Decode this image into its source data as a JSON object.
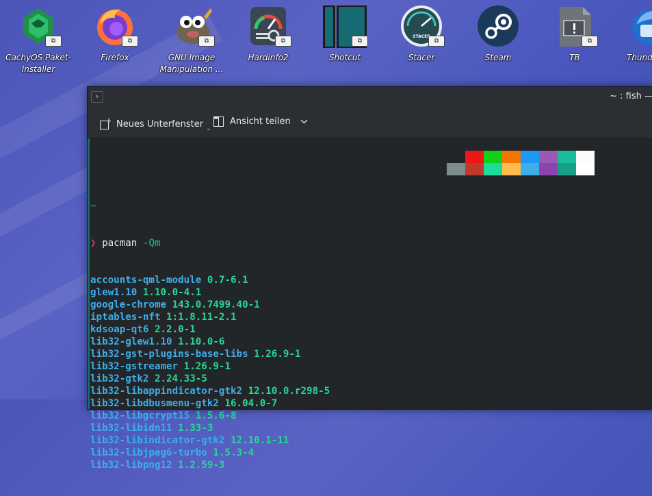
{
  "desktop": {
    "icons": [
      {
        "label_line1": "CachyOS Paket-",
        "label_line2": "Installer",
        "icon": "cachyos-package-installer-icon"
      },
      {
        "label_line1": "Firefox",
        "label_line2": "",
        "icon": "firefox-icon"
      },
      {
        "label_line1": "GNU Image",
        "label_line2": "Manipulation ...",
        "icon": "gimp-icon"
      },
      {
        "label_line1": "Hardinfo2",
        "label_line2": "",
        "icon": "hardinfo2-icon"
      },
      {
        "label_line1": "Shotcut",
        "label_line2": "",
        "icon": "shotcut-icon"
      },
      {
        "label_line1": "Stacer",
        "label_line2": "",
        "icon": "stacer-icon"
      },
      {
        "label_line1": "Steam",
        "label_line2": "",
        "icon": "steam-icon"
      },
      {
        "label_line1": "TB",
        "label_line2": "",
        "icon": "tb-file-icon"
      },
      {
        "label_line1": "Thund",
        "label_line2": "",
        "icon": "thunderbird-icon"
      }
    ],
    "stacer_icon_text": "STACER"
  },
  "window": {
    "title": "~ : fish —",
    "menu_button": "›",
    "toolbar": {
      "new_tab_label": "Neues Unterfenster",
      "split_view_label": "Ansicht teilen"
    }
  },
  "terminal": {
    "tilde": "~",
    "prompt_arrow": "❯",
    "command": "pacman",
    "command_option": "-Qm",
    "packages": [
      {
        "name": "accounts-qml-module",
        "version": "0.7-6.1"
      },
      {
        "name": "glew1.10",
        "version": "1.10.0-4.1"
      },
      {
        "name": "google-chrome",
        "version": "143.0.7499.40-1"
      },
      {
        "name": "iptables-nft",
        "version": "1:1.8.11-2.1"
      },
      {
        "name": "kdsoap-qt6",
        "version": "2.2.0-1"
      },
      {
        "name": "lib32-glew1.10",
        "version": "1.10.0-6"
      },
      {
        "name": "lib32-gst-plugins-base-libs",
        "version": "1.26.9-1"
      },
      {
        "name": "lib32-gstreamer",
        "version": "1.26.9-1"
      },
      {
        "name": "lib32-gtk2",
        "version": "2.24.33-5"
      },
      {
        "name": "lib32-libappindicator-gtk2",
        "version": "12.10.0.r298-5"
      },
      {
        "name": "lib32-libdbusmenu-gtk2",
        "version": "16.04.0-7"
      },
      {
        "name": "lib32-libgcrypt15",
        "version": "1.5.6-8"
      },
      {
        "name": "lib32-libidn11",
        "version": "1.33-3"
      },
      {
        "name": "lib32-libindicator-gtk2",
        "version": "12.10.1-11"
      },
      {
        "name": "lib32-libjpeg6-turbo",
        "version": "1.5.3-4"
      },
      {
        "name": "lib32-libpng12",
        "version": "1.2.59-3"
      }
    ],
    "palette_top": [
      "#232629",
      "#ed1515",
      "#11d116",
      "#f67400",
      "#1d99f3",
      "#9b59b6",
      "#1abc9c",
      "#fcfcfc"
    ],
    "palette_bottom": [
      "#7f8c8d",
      "#c0392b",
      "#1cdc9a",
      "#fdbc4b",
      "#3daee9",
      "#8e44ad",
      "#16a085",
      "#ffffff"
    ]
  }
}
